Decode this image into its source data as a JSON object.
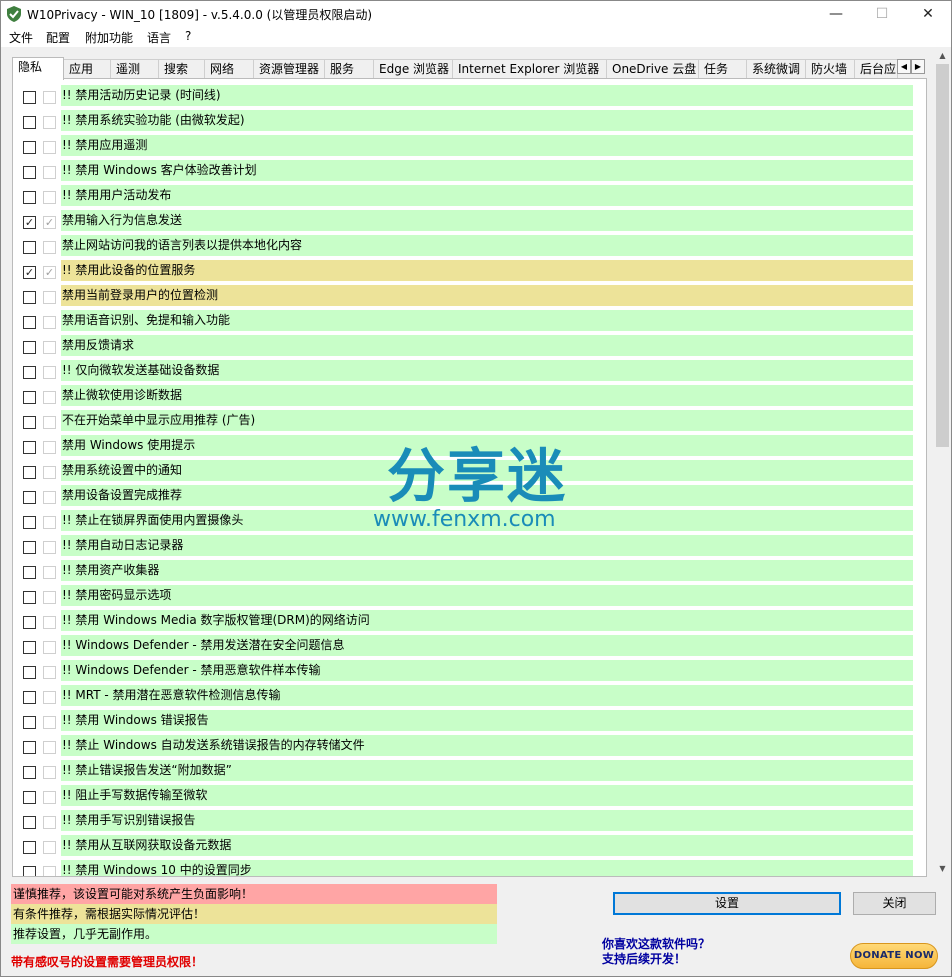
{
  "window": {
    "title": "W10Privacy - WIN_10 [1809]  - v.5.4.0.0 (以管理员权限启动)"
  },
  "menu": [
    "文件",
    "配置",
    "附加功能",
    "语言",
    "?"
  ],
  "tabs": [
    "隐私",
    "应用",
    "遥测",
    "搜索",
    "网络",
    "资源管理器",
    "服务",
    "Edge 浏览器",
    "Internet Explorer 浏览器",
    "OneDrive 云盘",
    "任务",
    "系统微调",
    "防火墙",
    "后台应"
  ],
  "active_tab": "隐私",
  "rows": [
    {
      "text": "!! 禁用活动历史记录 (时间线)",
      "checked": false,
      "color": "green"
    },
    {
      "text": "!! 禁用系统实验功能 (由微软发起)",
      "checked": false,
      "color": "green"
    },
    {
      "text": "!! 禁用应用遥测",
      "checked": false,
      "color": "green"
    },
    {
      "text": "!! 禁用 Windows 客户体验改善计划",
      "checked": false,
      "color": "green"
    },
    {
      "text": "!! 禁用用户活动发布",
      "checked": false,
      "color": "green"
    },
    {
      "text": "禁用输入行为信息发送",
      "checked": true,
      "color": "green"
    },
    {
      "text": "禁止网站访问我的语言列表以提供本地化内容",
      "checked": false,
      "color": "green"
    },
    {
      "text": "!! 禁用此设备的位置服务",
      "checked": true,
      "color": "yellow"
    },
    {
      "text": "禁用当前登录用户的位置检测",
      "checked": false,
      "color": "yellow"
    },
    {
      "text": "禁用语音识别、免提和输入功能",
      "checked": false,
      "color": "green"
    },
    {
      "text": "禁用反馈请求",
      "checked": false,
      "color": "green"
    },
    {
      "text": "!! 仅向微软发送基础设备数据",
      "checked": false,
      "color": "green"
    },
    {
      "text": "禁止微软使用诊断数据",
      "checked": false,
      "color": "green"
    },
    {
      "text": "不在开始菜单中显示应用推荐 (广告)",
      "checked": false,
      "color": "green"
    },
    {
      "text": "禁用 Windows 使用提示",
      "checked": false,
      "color": "green"
    },
    {
      "text": "禁用系统设置中的通知",
      "checked": false,
      "color": "green"
    },
    {
      "text": "禁用设备设置完成推荐",
      "checked": false,
      "color": "green"
    },
    {
      "text": "!! 禁止在锁屏界面使用内置摄像头",
      "checked": false,
      "color": "green"
    },
    {
      "text": "!! 禁用自动日志记录器",
      "checked": false,
      "color": "green"
    },
    {
      "text": "!! 禁用资产收集器",
      "checked": false,
      "color": "green"
    },
    {
      "text": "!! 禁用密码显示选项",
      "checked": false,
      "color": "green"
    },
    {
      "text": "!! 禁用 Windows Media 数字版权管理(DRM)的网络访问",
      "checked": false,
      "color": "green"
    },
    {
      "text": "!! Windows Defender - 禁用发送潜在安全问题信息",
      "checked": false,
      "color": "green"
    },
    {
      "text": "!! Windows Defender - 禁用恶意软件样本传输",
      "checked": false,
      "color": "green"
    },
    {
      "text": "!! MRT - 禁用潜在恶意软件检测信息传输",
      "checked": false,
      "color": "green"
    },
    {
      "text": "!! 禁用 Windows 错误报告",
      "checked": false,
      "color": "green"
    },
    {
      "text": "!! 禁止 Windows 自动发送系统错误报告的内存转储文件",
      "checked": false,
      "color": "green"
    },
    {
      "text": "!! 禁止错误报告发送“附加数据”",
      "checked": false,
      "color": "green"
    },
    {
      "text": "!! 阻止手写数据传输至微软",
      "checked": false,
      "color": "green"
    },
    {
      "text": "!! 禁用手写识别错误报告",
      "checked": false,
      "color": "green"
    },
    {
      "text": "!! 禁用从互联网获取设备元数据",
      "checked": false,
      "color": "green"
    },
    {
      "text": "!! 禁用 Windows 10 中的设置同步",
      "checked": false,
      "color": "green"
    }
  ],
  "watermark": {
    "big": "分享迷",
    "small": "www.fenxm.com"
  },
  "legend": {
    "red": "谨慎推荐，该设置可能对系统产生负面影响！",
    "yellow": "有条件推荐，需根据实际情况评估！",
    "green": "推荐设置，几乎无副作用。"
  },
  "admin_note": "带有感叹号的设置需要管理员权限！",
  "buttons": {
    "apply": "设置",
    "close": "关闭"
  },
  "promo": {
    "line1": "你喜欢这款软件吗？",
    "line2": "支持后续开发！"
  },
  "donate": "DONATE NOW",
  "colors": {
    "green": "#c8fec8",
    "yellow": "#ede399",
    "red": "#ffa5a5",
    "accent": "#0078d7"
  }
}
